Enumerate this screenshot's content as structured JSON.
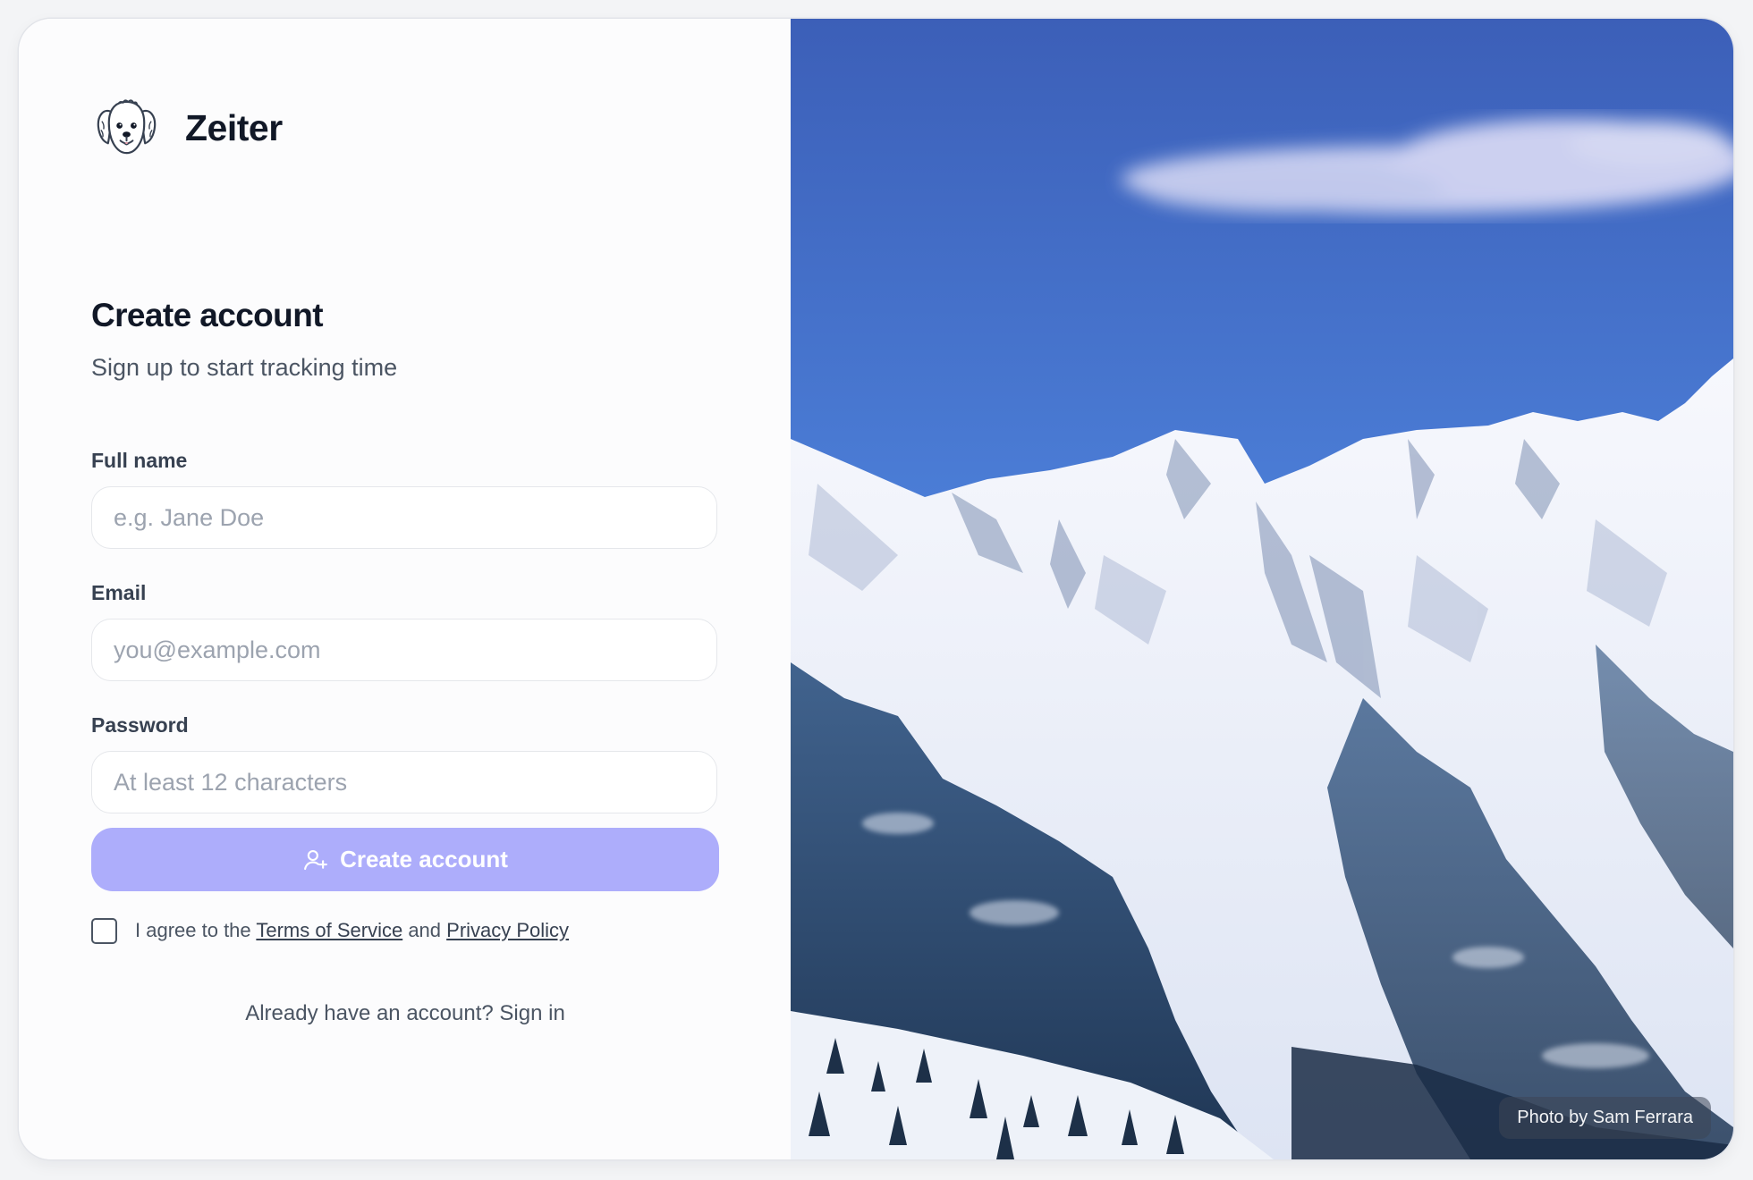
{
  "brand": {
    "name": "Zeiter",
    "logo_icon": "dog-face-icon"
  },
  "form": {
    "title": "Create account",
    "subtitle": "Sign up to start tracking time",
    "fields": {
      "full_name": {
        "label": "Full name",
        "placeholder": "e.g. Jane Doe",
        "value": ""
      },
      "email": {
        "label": "Email",
        "placeholder": "you@example.com",
        "value": ""
      },
      "password": {
        "label": "Password",
        "placeholder": "At least 12 characters",
        "value": ""
      }
    },
    "submit": {
      "label": "Create account",
      "icon": "user-plus-icon"
    },
    "agreement": {
      "prefix": "I agree to the ",
      "terms_label": "Terms of Service",
      "middle": " and ",
      "privacy_label": "Privacy Policy",
      "checked": false
    },
    "signin": {
      "prefix": "Already have an account? ",
      "link_label": "Sign in"
    }
  },
  "hero": {
    "credit": "Photo by Sam Ferrara"
  },
  "colors": {
    "accent_button": "#adadfb",
    "heading": "#111827",
    "muted_text": "#4b5563",
    "sky_top": "#3f63bd",
    "snow": "#f4f6fb"
  }
}
